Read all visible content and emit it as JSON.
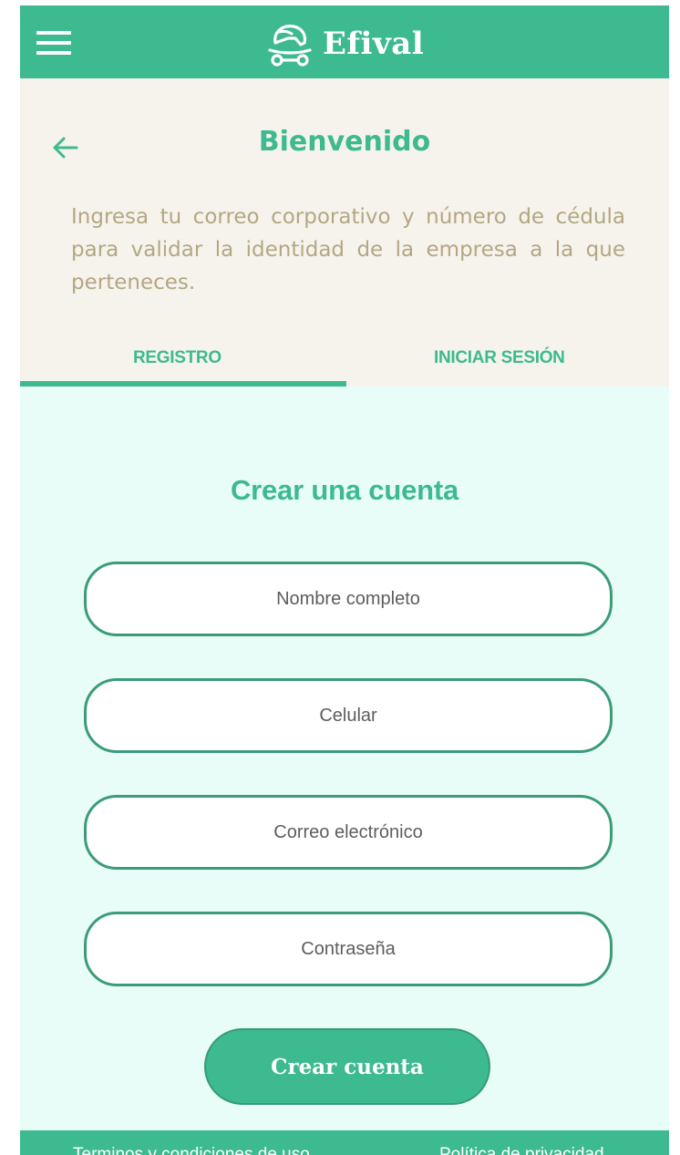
{
  "app": {
    "name": "Efival",
    "logo_icon": "helmet-scooter-icon",
    "menu_icon": "hamburger-menu-icon",
    "colors": {
      "primary": "#3dba8f",
      "header_bg": "#f6f3ec",
      "form_bg": "#e9fdf8",
      "intro_text": "#b3a783",
      "field_border": "#3a9c78"
    }
  },
  "header": {
    "back_icon": "arrow-left-icon",
    "title": "Bienvenido",
    "intro": "Ingresa tu correo corporativo y número de cédula para validar la identidad de la empresa a la que perteneces."
  },
  "tabs": [
    {
      "label": "REGISTRO",
      "active": true
    },
    {
      "label": "INICIAR SESIÓN",
      "active": false
    }
  ],
  "form": {
    "title": "Crear una cuenta",
    "fields": [
      {
        "placeholder": "Nombre completo",
        "value": ""
      },
      {
        "placeholder": "Celular",
        "value": ""
      },
      {
        "placeholder": "Correo electrónico",
        "value": ""
      },
      {
        "placeholder": "Contraseña",
        "value": ""
      }
    ],
    "submit_label": "Crear cuenta"
  },
  "footer": {
    "terms_label": "Terminos y condiciones de uso",
    "privacy_label": "Política de privacidad"
  }
}
